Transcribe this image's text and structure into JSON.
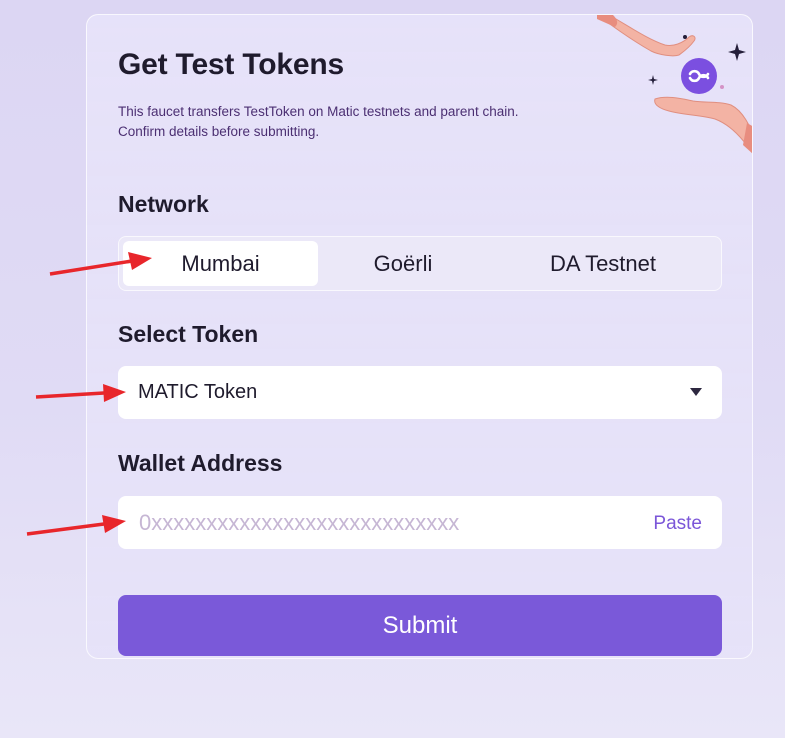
{
  "form": {
    "title": "Get Test Tokens",
    "description": "This faucet transfers TestToken on Matic testnets and parent chain. Confirm details before submitting."
  },
  "network": {
    "label": "Network",
    "options": [
      "Mumbai",
      "Goërli",
      "DA Testnet"
    ],
    "selected": "Mumbai"
  },
  "token": {
    "label": "Select Token",
    "selected": "MATIC Token"
  },
  "wallet": {
    "label": "Wallet Address",
    "placeholder": "0xxxxxxxxxxxxxxxxxxxxxxxxxxxx",
    "value": "",
    "paste_label": "Paste"
  },
  "submit_label": "Submit",
  "colors": {
    "accent": "#7a59d9",
    "annotation_arrow": "#e8262b",
    "logo": "#7b4fe0"
  },
  "icons": {
    "illustration": "hands-passing-polygon-coin",
    "caret": "triangle-down-icon",
    "annotations": "red-arrow-icon"
  }
}
